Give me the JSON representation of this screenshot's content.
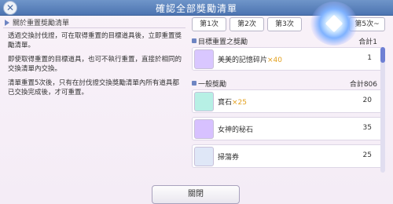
{
  "header": {
    "title": "確認全部獎勵清單",
    "close_icon": "close-icon"
  },
  "left": {
    "header_label": "關於重置獎勵清單",
    "paragraphs": [
      "透過交換討伐證，可在取得重置的目標道具後，立即重置獎勵清單。",
      "即使取得重置的目標道具，也可不執行重置，直接於相同的交換清單內交換。",
      "清單重置5次後，只有在討伐證交換獎勵清單內所有道具都已交換完成後，才可重置。"
    ]
  },
  "tabs": [
    "第1次",
    "第2次",
    "第3次",
    "第5次~"
  ],
  "sections": [
    {
      "name": "目標重置之獎勵",
      "total": "合計1"
    },
    {
      "name": "一般獎勵",
      "total": "合計806"
    }
  ],
  "items": [
    {
      "name": "美美的記憶碎片",
      "mult": "×40",
      "count": "1",
      "thumb_color": "#d9c7ff"
    },
    {
      "name": "寶石",
      "mult": "×25",
      "count": "20",
      "thumb_color": "#b7f0e5"
    },
    {
      "name": "女神的秘石",
      "mult": "",
      "count": "35",
      "thumb_color": "#d7c1ff"
    },
    {
      "name": "掃蕩券",
      "mult": "",
      "count": "25",
      "thumb_color": "#dfe7f7"
    }
  ],
  "bottom": {
    "close_label": "關閉"
  }
}
